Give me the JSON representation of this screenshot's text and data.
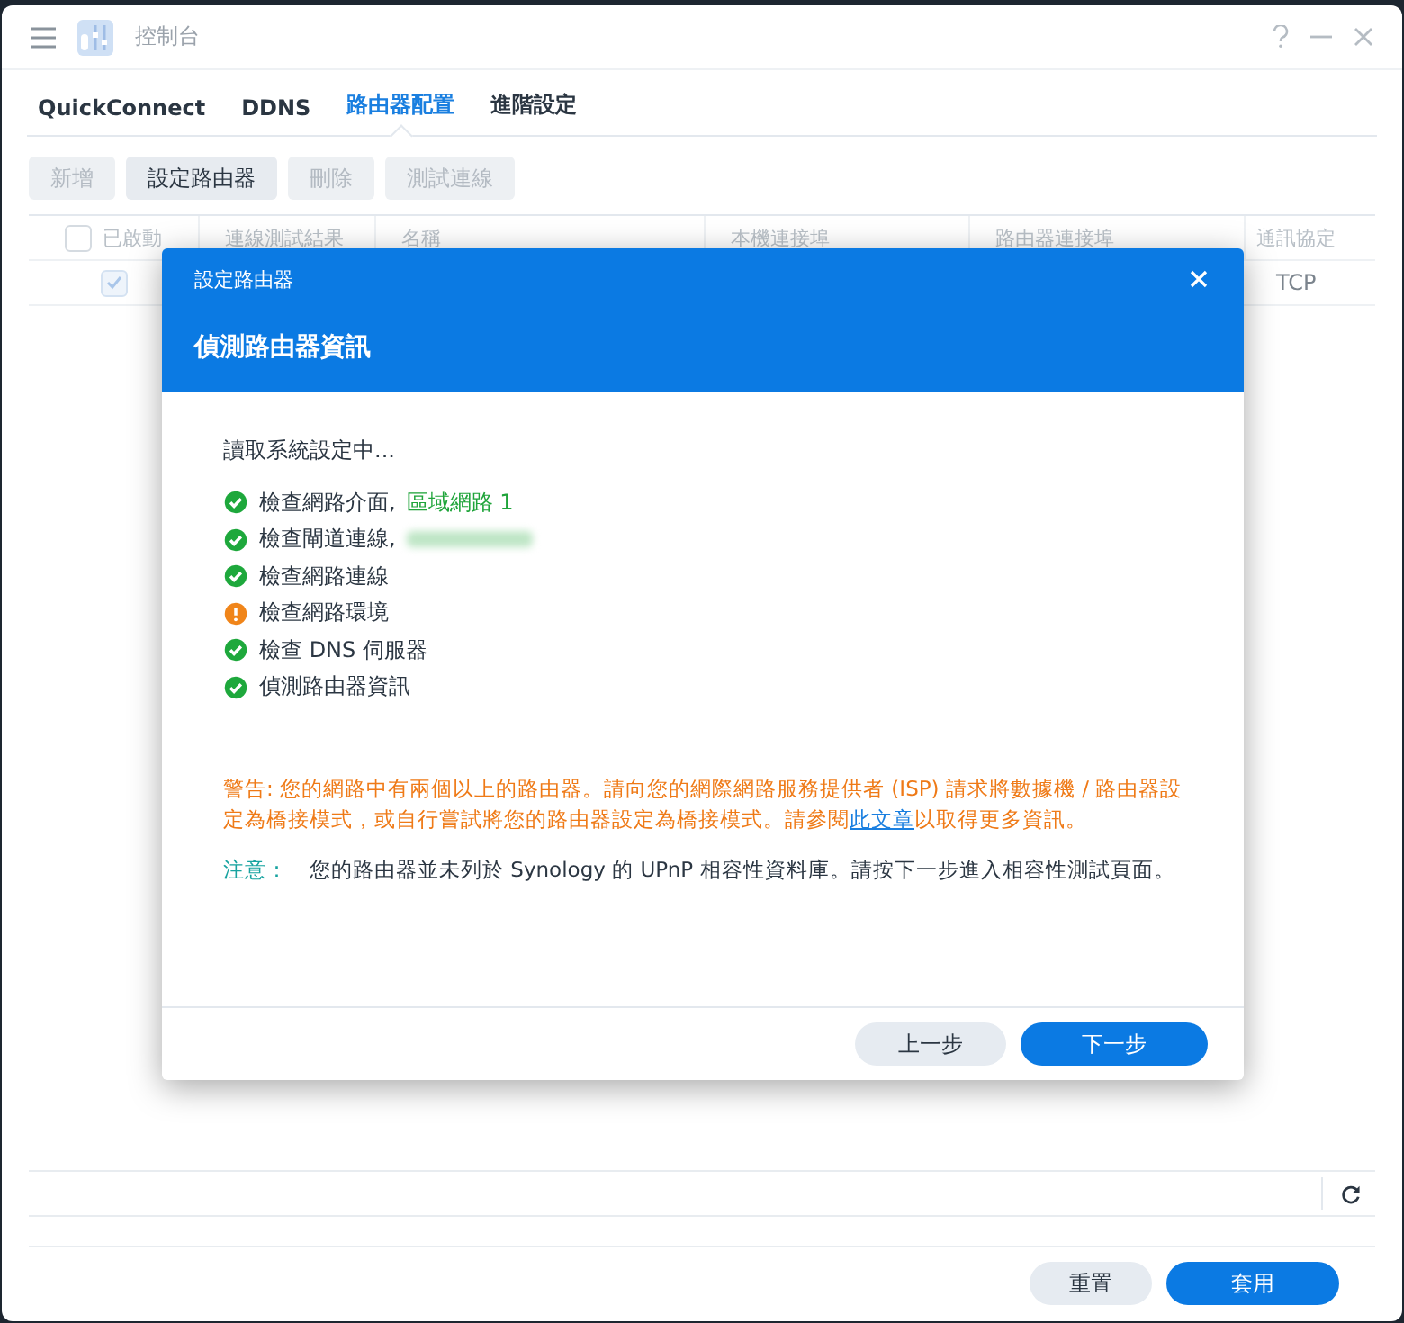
{
  "window": {
    "title": "控制台"
  },
  "tabs": [
    {
      "label": "QuickConnect",
      "selected": false
    },
    {
      "label": "DDNS",
      "selected": false
    },
    {
      "label": "路由器配置",
      "selected": true
    },
    {
      "label": "進階設定",
      "selected": false
    }
  ],
  "toolbar": [
    {
      "label": "新增",
      "disabled": true
    },
    {
      "label": "設定路由器",
      "disabled": false
    },
    {
      "label": "刪除",
      "disabled": true
    },
    {
      "label": "測試連線",
      "disabled": true
    }
  ],
  "table": {
    "select_all_checked": false,
    "columns": [
      {
        "label": "已啟動"
      },
      {
        "label": "連線測試結果"
      },
      {
        "label": "名稱"
      },
      {
        "label": "本機連接埠"
      },
      {
        "label": "路由器連接埠"
      },
      {
        "label": "通訊協定"
      }
    ],
    "rows": [
      {
        "checked": true,
        "protocol": "TCP"
      }
    ]
  },
  "dialog": {
    "title": "設定路由器",
    "heading": "偵測路由器資訊",
    "status_text": "讀取系統設定中...",
    "checks": [
      {
        "label": "檢查網路介面,",
        "value": "區域網路 1",
        "kind": "ok",
        "redacted": false
      },
      {
        "label": "檢查閘道連線,",
        "kind": "ok",
        "redacted": true
      },
      {
        "label": "檢查網路連線",
        "kind": "ok",
        "redacted": false
      },
      {
        "label": "檢查網路環境",
        "kind": "warning",
        "redacted": false
      },
      {
        "label": "檢查 DNS 伺服器",
        "kind": "ok",
        "redacted": false
      },
      {
        "label": "偵測路由器資訊",
        "kind": "ok",
        "redacted": false
      }
    ],
    "warning": {
      "text_before": "警告: 您的網路中有兩個以上的路由器。請向您的網際網路服務提供者 (ISP) 請求將數據機 / 路由器設定為橋接模式，或自行嘗試將您的路由器設定為橋接模式。請參閱",
      "link": "此文章",
      "text_after": "以取得更多資訊。"
    },
    "note": {
      "label": "注意：",
      "text": "您的路由器並未列於 Synology 的 UPnP 相容性資料庫。請按下一步進入相容性測試頁面。"
    },
    "buttons": [
      {
        "label": "上一步",
        "kind": "secondary"
      },
      {
        "label": "下一步",
        "kind": "primary"
      }
    ]
  },
  "footer_buttons": [
    {
      "label": "重置",
      "kind": "secondary"
    },
    {
      "label": "套用",
      "kind": "primary"
    }
  ]
}
